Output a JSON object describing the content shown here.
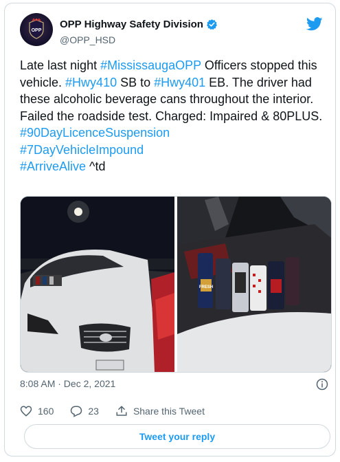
{
  "author": {
    "display_name": "OPP Highway Safety Division",
    "handle": "@OPP_HSD",
    "avatar_text": "OPP",
    "verified": true
  },
  "tweet": {
    "segments": [
      {
        "text": "Late last night ",
        "tag": false
      },
      {
        "text": "#MississaugaOPP",
        "tag": true
      },
      {
        "text": " Officers stopped this vehicle. ",
        "tag": false
      },
      {
        "text": "#Hwy410",
        "tag": true
      },
      {
        "text": " SB to ",
        "tag": false
      },
      {
        "text": "#Hwy401",
        "tag": true
      },
      {
        "text": " EB. The driver had these alcoholic beverage cans throughout the interior. Failed the roadside test. Charged: Impaired & 80PLUS.\n",
        "tag": false
      },
      {
        "text": "#90DayLicenceSuspension",
        "tag": true
      },
      {
        "text": "\n",
        "tag": false
      },
      {
        "text": "#7DayVehicleImpound",
        "tag": true
      },
      {
        "text": "\n",
        "tag": false
      },
      {
        "text": "#ArriveAlive",
        "tag": true
      },
      {
        "text": " ^td",
        "tag": false
      }
    ]
  },
  "media": {
    "photo_right_brand": "FRESH"
  },
  "meta": {
    "timestamp": "8:08 AM · Dec 2, 2021"
  },
  "actions": {
    "likes": "160",
    "replies": "23",
    "share_label": "Share this Tweet"
  },
  "reply_button": {
    "label": "Tweet your reply"
  },
  "colors": {
    "accent": "#1d9bf0",
    "text": "#0f1419",
    "muted": "#536471",
    "border": "#cfd9de"
  }
}
